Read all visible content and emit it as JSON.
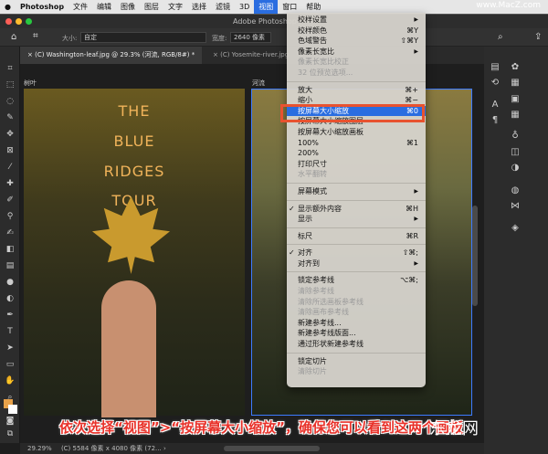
{
  "menubar": {
    "apple": "",
    "app": "Photoshop",
    "items": [
      "文件",
      "编辑",
      "图像",
      "图层",
      "文字",
      "选择",
      "滤镜",
      "3D",
      "视图",
      "窗口",
      "帮助"
    ],
    "watermark": "www.MacZ.com"
  },
  "window": {
    "title": "Adobe Photoshop"
  },
  "options": {
    "size_label": "大小:",
    "size_value": "自定",
    "width_label": "宽度:",
    "width_value": "2640 像素"
  },
  "tabs": [
    {
      "label": "(C) Washington-leaf.jpg @ 29.3% (河流, RGB/8#) *"
    },
    {
      "label": "(C) Yosemite-river.jpg"
    }
  ],
  "artboards": [
    {
      "label": "树叶",
      "poster": [
        "THE",
        "BLUE",
        "RIDGES",
        "TOUR"
      ]
    },
    {
      "label": "河流"
    }
  ],
  "view_menu": [
    {
      "label": "校样设置",
      "sub": true
    },
    {
      "label": "校样颜色",
      "sc": "⌘Y"
    },
    {
      "label": "色域警告",
      "sc": "⇧⌘Y"
    },
    {
      "label": "像素长宽比",
      "sub": true
    },
    {
      "label": "像素长宽比校正",
      "dis": true
    },
    {
      "label": "32 位预览选项...",
      "dis": true
    },
    {
      "sep": true
    },
    {
      "label": "放大",
      "sc": "⌘+"
    },
    {
      "label": "缩小",
      "sc": "⌘−"
    },
    {
      "label": "按屏幕大小缩放",
      "sc": "⌘0",
      "hl": true
    },
    {
      "label": "按屏幕大小缩放图层"
    },
    {
      "label": "按屏幕大小缩放画板"
    },
    {
      "label": "100%",
      "sc": "⌘1"
    },
    {
      "label": "200%"
    },
    {
      "label": "打印尺寸"
    },
    {
      "label": "水平翻转",
      "dis": true
    },
    {
      "sep": true
    },
    {
      "label": "屏幕模式",
      "sub": true
    },
    {
      "sep": true
    },
    {
      "label": "显示额外内容",
      "sc": "⌘H",
      "check": true
    },
    {
      "label": "显示",
      "sub": true
    },
    {
      "sep": true
    },
    {
      "label": "标尺",
      "sc": "⌘R"
    },
    {
      "sep": true
    },
    {
      "label": "对齐",
      "sc": "⇧⌘;",
      "check": true
    },
    {
      "label": "对齐到",
      "sub": true
    },
    {
      "sep": true
    },
    {
      "label": "锁定参考线",
      "sc": "⌥⌘;"
    },
    {
      "label": "清除参考线",
      "dis": true
    },
    {
      "label": "清除所选画板参考线",
      "dis": true
    },
    {
      "label": "清除画布参考线",
      "dis": true
    },
    {
      "label": "新建参考线..."
    },
    {
      "label": "新建参考线版面..."
    },
    {
      "label": "通过形状新建参考线"
    },
    {
      "sep": true
    },
    {
      "label": "锁定切片"
    },
    {
      "label": "清除切片",
      "dis": true
    }
  ],
  "caption": "依次选择“视图”>“按屏幕大小缩放”，确保您可以看到这两个画板",
  "logo": "东龙网",
  "status": {
    "zoom": "29.29%",
    "info": "(C) 5584 像素 x 4080 像素 (72... ›"
  },
  "colors": {
    "accent": "#2a6de0",
    "highlight_box": "#e8522f",
    "caption": "#e8322a"
  }
}
